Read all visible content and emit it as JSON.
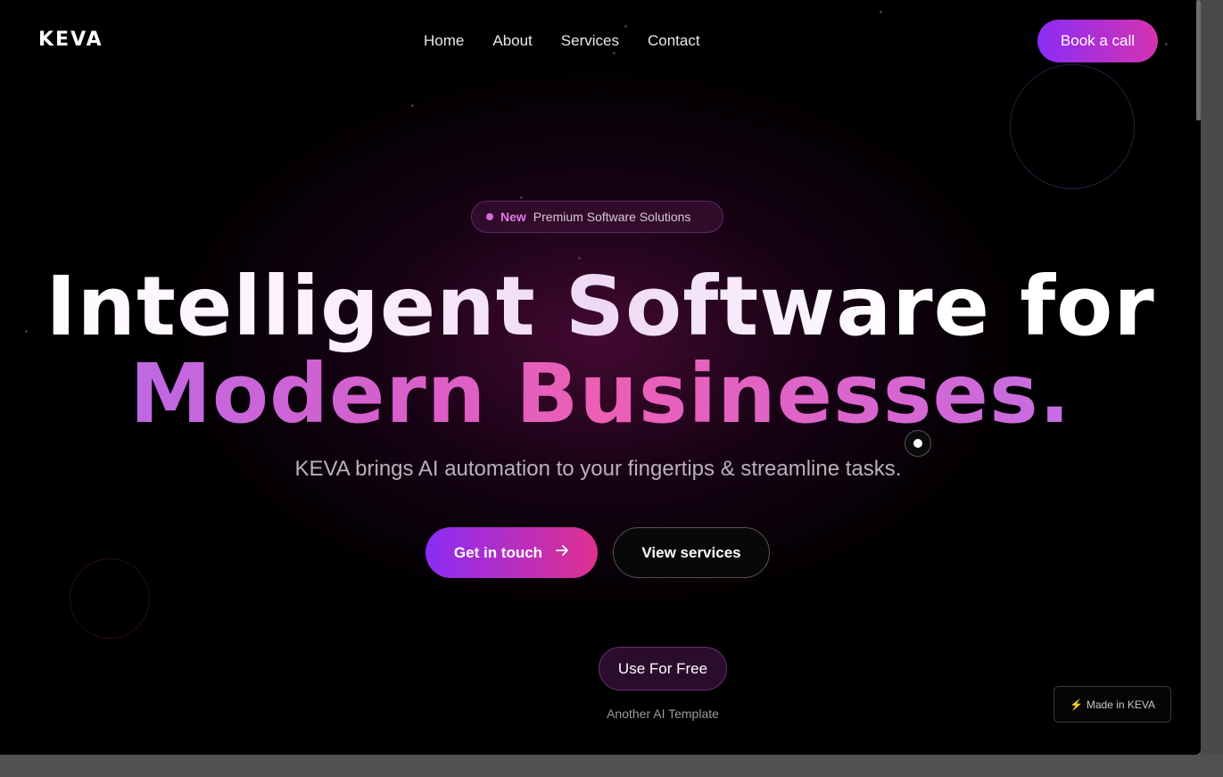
{
  "header": {
    "logo": "KEVA",
    "nav": [
      "Home",
      "About",
      "Services",
      "Contact"
    ],
    "cta_label": "Book a call"
  },
  "hero": {
    "badge_new": "New",
    "badge_text": "Premium Software Solutions",
    "title_line1": "Intelligent Software for",
    "title_line2": "Modern Businesses.",
    "subtitle": "KEVA brings AI automation to your fingertips & streamline tasks.",
    "primary_button": "Get in touch",
    "secondary_button": "View services"
  },
  "footer": {
    "free_button": "Use For Free",
    "another_text": "Another AI Template",
    "made_in": "Made in KEVA"
  },
  "colors": {
    "accent_start": "#8b2cf5",
    "accent_end": "#e0308e",
    "background": "#000000"
  }
}
